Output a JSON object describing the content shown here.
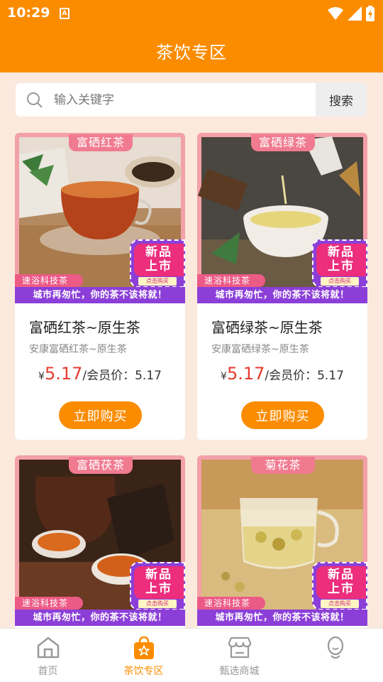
{
  "status_bar": {
    "time": "10:29",
    "notification_letter": "A"
  },
  "app_bar": {
    "title": "茶饮专区"
  },
  "search": {
    "placeholder": "输入关键字",
    "button_label": "搜索"
  },
  "products": [
    {
      "category": "富硒红茶",
      "title": "富硒红茶~原生茶",
      "subtitle": "安康富硒红茶~原生茶",
      "currency": "¥",
      "price": "5.17",
      "member_label": "/会员价：",
      "member_price": "5.17",
      "buy_label": "立即购买",
      "badge_new": "新品",
      "badge_market": "上市",
      "badge_click": "点击购买",
      "brand": "速浴科技茶",
      "slogan": "城市再匆忙，你的茶不该将就！"
    },
    {
      "category": "富硒绿茶",
      "title": "富硒绿茶~原生茶",
      "subtitle": "安康富硒绿茶~原生茶",
      "currency": "¥",
      "price": "5.17",
      "member_label": "/会员价：",
      "member_price": "5.17",
      "buy_label": "立即购买",
      "badge_new": "新品",
      "badge_market": "上市",
      "badge_click": "点击购买",
      "brand": "速浴科技茶",
      "slogan": "城市再匆忙，你的茶不该将就！"
    },
    {
      "category": "富硒茯茶",
      "badge_new": "新品",
      "badge_market": "上市",
      "badge_click": "点击购买",
      "brand": "速浴科技茶",
      "slogan": "城市再匆忙，你的茶不该将就！"
    },
    {
      "category": "菊花茶",
      "badge_new": "新品",
      "badge_market": "上市",
      "badge_click": "点击购买",
      "brand": "速浴科技茶",
      "slogan": "城市再匆忙，你的茶不该将就！"
    }
  ],
  "bottom_nav": [
    {
      "label": "首页",
      "icon": "home-icon",
      "active": false
    },
    {
      "label": "茶饮专区",
      "icon": "shopping-bag-icon",
      "active": true
    },
    {
      "label": "甄选商城",
      "icon": "storefront-icon",
      "active": false
    },
    {
      "label": "",
      "icon": "profile-icon",
      "active": false
    }
  ],
  "colors": {
    "primary": "#fb8c00",
    "price": "#e63b2e",
    "background": "#fbe9dd",
    "badge_purple": "#8b3fd8",
    "badge_pink": "#ec2e7d"
  }
}
